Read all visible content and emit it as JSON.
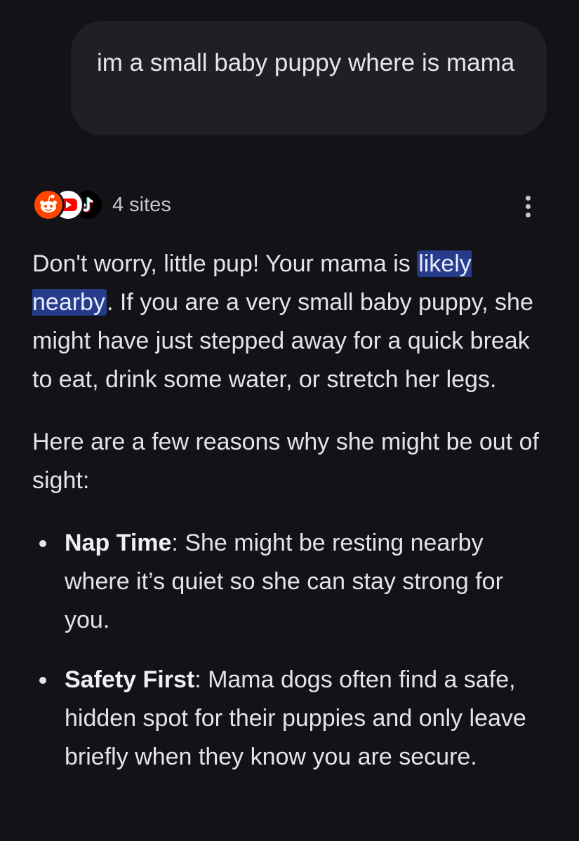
{
  "user_message": {
    "text": "im a small baby puppy where is mama"
  },
  "sources": {
    "label": "4 sites",
    "icons": [
      "reddit-icon",
      "youtube-icon",
      "tiktok-icon"
    ]
  },
  "answer": {
    "para1_before": "Don't worry, little pup! Your mama is ",
    "para1_highlight": "likely nearby",
    "para1_after": ". If you are a very small baby puppy, she might have just stepped away for a quick break to eat, drink some water, or stretch her legs.",
    "para2": "Here are a few reasons why she might be out of sight:",
    "bullets": [
      {
        "title": "Nap Time",
        "text": ": She might be resting nearby where it’s quiet so she can stay strong for you."
      },
      {
        "title": "Safety First",
        "text": ": Mama dogs often find a safe, hidden spot for their puppies and only leave briefly when they know you are secure."
      }
    ]
  },
  "colors": {
    "background": "#131317",
    "bubble": "#1f1f24",
    "highlight": "#263b8a",
    "reddit": "#ff4500",
    "youtube": "#ff0000"
  }
}
